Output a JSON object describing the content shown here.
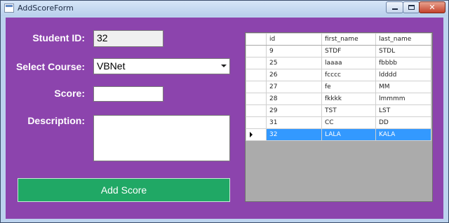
{
  "window": {
    "title": "AddScoreForm"
  },
  "form": {
    "student_id_label": "Student ID:",
    "student_id_value": "32",
    "course_label": "Select Course:",
    "course_value": "VBNet",
    "score_label": "Score:",
    "score_value": "",
    "description_label": "Description:",
    "description_value": "",
    "add_button": "Add Score"
  },
  "grid": {
    "columns": [
      "id",
      "first_name",
      "last_name"
    ],
    "rows": [
      {
        "id": "9",
        "first_name": "STDF",
        "last_name": "STDL"
      },
      {
        "id": "25",
        "first_name": "laaaa",
        "last_name": "fbbbb"
      },
      {
        "id": "26",
        "first_name": "fcccc",
        "last_name": "ldddd"
      },
      {
        "id": "27",
        "first_name": "fe",
        "last_name": "MM"
      },
      {
        "id": "28",
        "first_name": "fkkkk",
        "last_name": "lmmmm"
      },
      {
        "id": "29",
        "first_name": "TST",
        "last_name": "LST"
      },
      {
        "id": "31",
        "first_name": "CC",
        "last_name": "DD"
      },
      {
        "id": "32",
        "first_name": "LALA",
        "last_name": "KALA"
      }
    ],
    "selected_row": 7
  }
}
